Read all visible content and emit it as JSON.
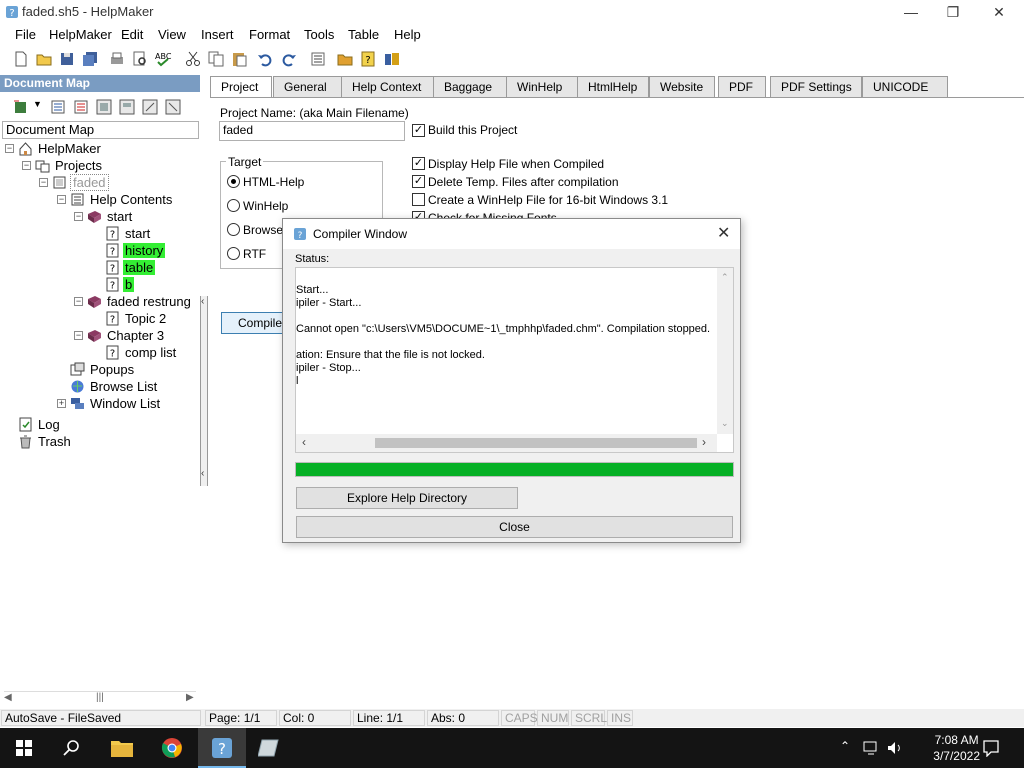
{
  "window": {
    "title": "faded.sh5 - HelpMaker"
  },
  "menu": [
    "File",
    "HelpMaker",
    "Edit",
    "View",
    "Insert",
    "Format",
    "Tools",
    "Table",
    "Help"
  ],
  "toolbar_icons": [
    "new-file-icon",
    "open-folder-icon",
    "save-icon",
    "save-all-icon",
    "print-icon",
    "print-preview-icon",
    "spellcheck-icon",
    "cut-icon",
    "copy-icon",
    "paste-icon",
    "undo-icon",
    "redo-icon",
    "properties-icon",
    "folder-icon",
    "help-icon",
    "compile-icon"
  ],
  "docmap": {
    "header": "Document Map",
    "field": "Document Map",
    "tree": [
      {
        "label": "HelpMaker",
        "icon": "home-icon",
        "level": 0,
        "expander": "-",
        "hl": false
      },
      {
        "label": "Projects",
        "icon": "projects-icon",
        "level": 1,
        "expander": "-",
        "hl": false
      },
      {
        "label": "faded",
        "icon": "project-icon",
        "level": 2,
        "expander": "-",
        "hl": false,
        "selected": true
      },
      {
        "label": "Help Contents",
        "icon": "contents-icon",
        "level": 3,
        "expander": "-",
        "hl": false
      },
      {
        "label": "start",
        "icon": "book-icon",
        "level": 4,
        "expander": "-",
        "hl": false
      },
      {
        "label": "start",
        "icon": "topic-icon",
        "level": 5,
        "expander": "",
        "hl": false
      },
      {
        "label": "history",
        "icon": "topic-icon",
        "level": 5,
        "expander": "",
        "hl": true
      },
      {
        "label": "table",
        "icon": "topic-icon",
        "level": 5,
        "expander": "",
        "hl": true
      },
      {
        "label": "b",
        "icon": "topic-icon",
        "level": 5,
        "expander": "",
        "hl": true
      },
      {
        "label": "faded restrung",
        "icon": "book-icon",
        "level": 4,
        "expander": "-",
        "hl": false
      },
      {
        "label": "Topic 2",
        "icon": "topic-icon",
        "level": 5,
        "expander": "",
        "hl": false
      },
      {
        "label": "Chapter 3",
        "icon": "book-icon",
        "level": 4,
        "expander": "-",
        "hl": false
      },
      {
        "label": "comp list",
        "icon": "topic-icon",
        "level": 5,
        "expander": "",
        "hl": false
      },
      {
        "label": "Popups",
        "icon": "popups-icon",
        "level": 3,
        "expander": "",
        "hl": false
      },
      {
        "label": "Browse List",
        "icon": "browse-icon",
        "level": 3,
        "expander": "",
        "hl": false
      },
      {
        "label": "Window List",
        "icon": "window-list-icon",
        "level": 3,
        "expander": "+",
        "hl": false
      },
      {
        "label": "Log",
        "icon": "log-icon",
        "level": 0,
        "expander": "",
        "hl": false
      },
      {
        "label": "Trash",
        "icon": "trash-icon",
        "level": 0,
        "expander": "",
        "hl": false
      }
    ]
  },
  "tabs": [
    "Project",
    "General",
    "Help Context",
    "Baggage",
    "WinHelp",
    "HtmlHelp",
    "Website",
    "PDF",
    "PDF Settings",
    "UNICODE"
  ],
  "project": {
    "name_label": "Project Name: (aka Main Filename)",
    "name_value": "faded",
    "build_label": "Build this Project",
    "target_label": "Target",
    "targets": [
      "HTML-Help",
      "WinHelp",
      "Browser",
      "RTF"
    ],
    "options": [
      {
        "label": "Display Help File when Compiled",
        "checked": true
      },
      {
        "label": "Delete Temp. Files after compilation",
        "checked": true
      },
      {
        "label": "Create a WinHelp File for 16-bit Windows 3.1",
        "checked": false
      },
      {
        "label": "Check for Missing Fonts",
        "checked": true
      }
    ],
    "compile_label": "Compile"
  },
  "dialog": {
    "title": "Compiler Window",
    "status_label": "Status:",
    "log": [
      "Start...",
      "ipiler - Start...",
      "",
      " Cannot open \"c:\\Users\\VM5\\DOCUME~1\\_tmphhp\\faded.chm\". Compilation stopped.",
      "",
      "ation: Ensure that the file is not locked.",
      "ipiler - Stop...",
      "l"
    ],
    "progress": 1.0,
    "explore_label": "Explore Help Directory",
    "close_label": "Close"
  },
  "statusbar": {
    "autosave": "AutoSave - FileSaved",
    "page": "Page: 1/1",
    "col": "Col: 0",
    "line": "Line: 1/1",
    "abs": "Abs: 0",
    "caps": "CAPS",
    "num": "NUM",
    "scrl": "SCRL",
    "ins": "INS"
  },
  "taskbar": {
    "time": "7:08 AM",
    "date": "3/7/2022"
  },
  "colors": {
    "accent": "#7a9cc2",
    "highlight": "#33ee33",
    "progress": "#06b025",
    "taskbar": "#141414"
  }
}
